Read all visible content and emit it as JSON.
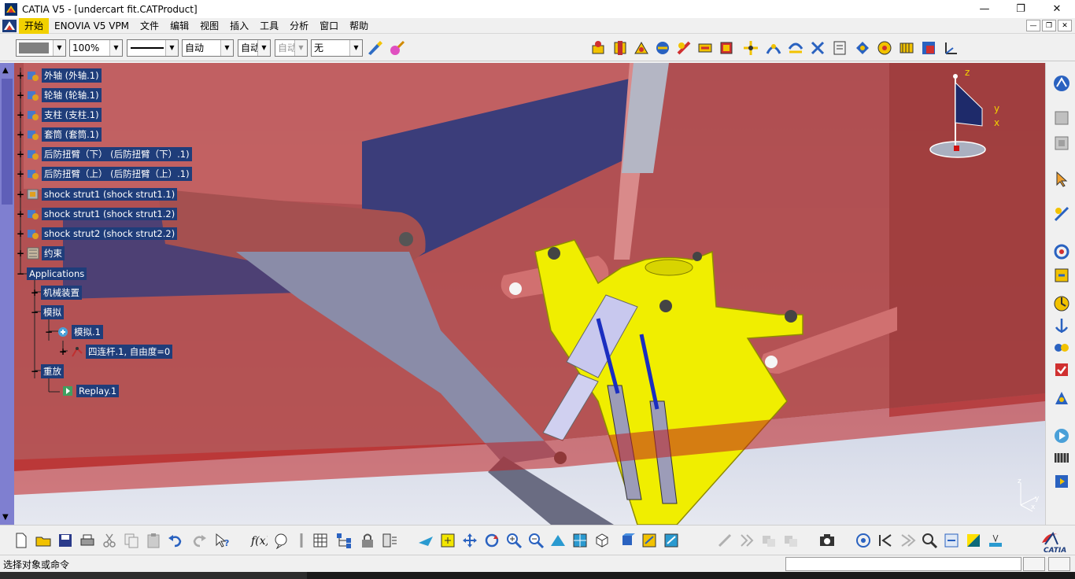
{
  "window": {
    "title": "CATIA V5 - [undercart fit.CATProduct]",
    "minimize_glyph": "—",
    "maximize_glyph": "❐",
    "close_glyph": "✕"
  },
  "menu": {
    "items": [
      "开始",
      "ENOVIA V5 VPM",
      "文件",
      "编辑",
      "视图",
      "插入",
      "工具",
      "分析",
      "窗口",
      "帮助"
    ],
    "active": "开始"
  },
  "properties": {
    "color_value": "",
    "transparency_value": "100%",
    "linetype_value": "",
    "thickness_value": "自动",
    "layer_value": "自动",
    "layer2_value": "自动",
    "none_value": "无"
  },
  "tree": {
    "nodes": [
      {
        "label": "外轴 (外轴.1)",
        "icon": "part-icon"
      },
      {
        "label": "轮轴 (轮轴.1)",
        "icon": "part-icon"
      },
      {
        "label": "支柱 (支柱.1)",
        "icon": "part-icon"
      },
      {
        "label": "套筒 (套筒.1)",
        "icon": "part-icon"
      },
      {
        "label": "后防扭臂（下） (后防扭臂（下）.1)",
        "icon": "part-icon"
      },
      {
        "label": "后防扭臂（上） (后防扭臂（上）.1)",
        "icon": "part-icon"
      },
      {
        "label": "shock strut1 (shock strut1.1)",
        "icon": "assembly-icon"
      },
      {
        "label": "shock strut1 (shock strut1.2)",
        "icon": "part-icon"
      },
      {
        "label": "shock strut2 (shock strut2.2)",
        "icon": "part-icon"
      },
      {
        "label": "约束",
        "icon": "constraints-icon"
      },
      {
        "label": "Applications",
        "icon": ""
      },
      {
        "label": "机械装置",
        "icon": ""
      },
      {
        "label": "模拟",
        "icon": ""
      },
      {
        "label": "模拟.1",
        "icon": "simulation-icon"
      },
      {
        "label": "四连杆.1, 自由度=0",
        "icon": "mechanism-icon"
      },
      {
        "label": "重放",
        "icon": ""
      },
      {
        "label": "Replay.1",
        "icon": "replay-icon"
      }
    ]
  },
  "compass": {
    "axis_z": "z",
    "axis_y": "y",
    "axis_x": "x"
  },
  "mini_axes": {
    "z": "z",
    "y": "y",
    "x": "x"
  },
  "status": {
    "prompt": "选择对象或命令",
    "command_value": ""
  },
  "colors": {
    "tree_label_bg": "#1f3d7a",
    "active_menu": "#f2d100",
    "part_yellow": "#f0ee00",
    "body_red": "#c0484a",
    "scroll_blue": "#7f7fd0"
  },
  "brand": {
    "catia_logo_text": "CATIA"
  }
}
